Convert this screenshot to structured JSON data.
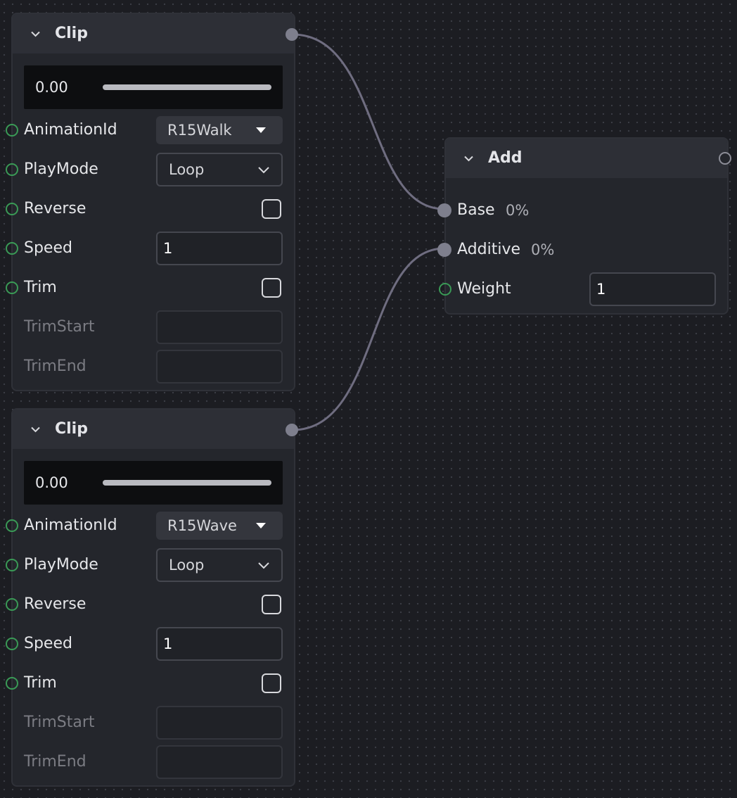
{
  "canvas": {
    "background": "#1c1d22",
    "wire_color": "#6f6d80",
    "port_color": "#7e7f8d",
    "input_port_ring": "#3a9a56"
  },
  "nodes": [
    {
      "title": "Clip",
      "preview": {
        "time": "0.00",
        "progress": 0
      },
      "animation_id": {
        "label": "AnimationId",
        "value": "R15Walk"
      },
      "play_mode": {
        "label": "PlayMode",
        "value": "Loop"
      },
      "reverse": {
        "label": "Reverse",
        "checked": false
      },
      "speed": {
        "label": "Speed",
        "value": "1"
      },
      "trim": {
        "label": "Trim",
        "checked": false
      },
      "trim_start": {
        "label": "TrimStart",
        "value": ""
      },
      "trim_end": {
        "label": "TrimEnd",
        "value": ""
      }
    },
    {
      "title": "Clip",
      "preview": {
        "time": "0.00",
        "progress": 0
      },
      "animation_id": {
        "label": "AnimationId",
        "value": "R15Wave"
      },
      "play_mode": {
        "label": "PlayMode",
        "value": "Loop"
      },
      "reverse": {
        "label": "Reverse",
        "checked": false
      },
      "speed": {
        "label": "Speed",
        "value": "1"
      },
      "trim": {
        "label": "Trim",
        "checked": false
      },
      "trim_start": {
        "label": "TrimStart",
        "value": ""
      },
      "trim_end": {
        "label": "TrimEnd",
        "value": ""
      }
    }
  ],
  "add_node": {
    "title": "Add",
    "base": {
      "label": "Base",
      "percent": "0%"
    },
    "additive": {
      "label": "Additive",
      "percent": "0%"
    },
    "weight": {
      "label": "Weight",
      "value": "1"
    }
  },
  "icons": {
    "collapse": "chevron-down-icon",
    "dropdown_filled": "triangle-down-icon",
    "dropdown_outlined": "chevron-down-icon",
    "checkbox": "checkbox-empty-icon"
  }
}
